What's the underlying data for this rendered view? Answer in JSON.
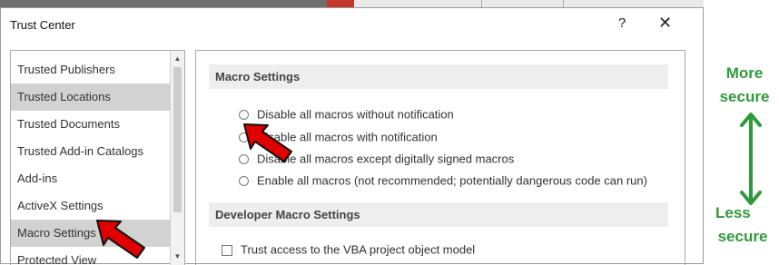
{
  "window": {
    "title": "Trust Center",
    "help_label": "?",
    "close_label": "✕"
  },
  "sidebar": {
    "items": [
      {
        "label": "Trusted Publishers",
        "selected": false
      },
      {
        "label": "Trusted Locations",
        "selected": true
      },
      {
        "label": "Trusted Documents",
        "selected": false
      },
      {
        "label": "Trusted Add-in Catalogs",
        "selected": false
      },
      {
        "label": "Add-ins",
        "selected": false
      },
      {
        "label": "ActiveX Settings",
        "selected": false
      },
      {
        "label": "Macro Settings",
        "selected": true
      },
      {
        "label": "Protected View",
        "selected": false
      }
    ]
  },
  "macro_settings": {
    "header": "Macro Settings",
    "options": [
      {
        "label": "Disable all macros without notification",
        "selected": false
      },
      {
        "label": "Disable all macros with notification",
        "selected": true
      },
      {
        "label": "Disable all macros except digitally signed macros",
        "selected": false
      },
      {
        "label": "Enable all macros (not recommended; potentially dangerous code can run)",
        "selected": false
      }
    ]
  },
  "developer_macro_settings": {
    "header": "Developer Macro Settings",
    "vba_access_label": "Trust access to the VBA project object model",
    "vba_access_checked": false
  },
  "annotation": {
    "top_label_line1": "More",
    "top_label_line2": "secure",
    "bottom_label_line1": "Less",
    "bottom_label_line2": "secure",
    "color": "#2e9b3a",
    "arrow_color": "#cc0000"
  }
}
